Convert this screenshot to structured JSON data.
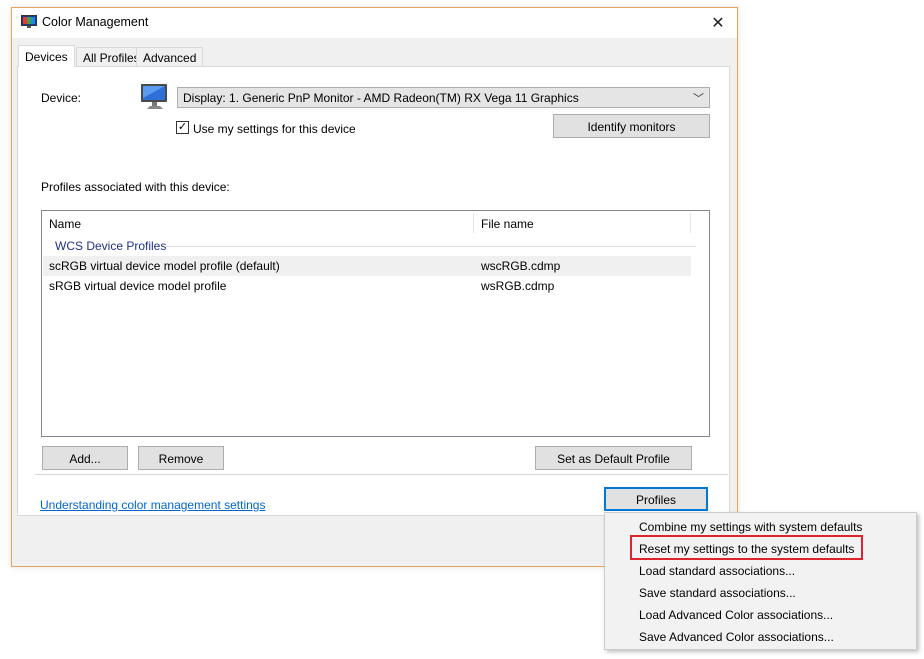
{
  "window": {
    "title": "Color Management",
    "close_symbol": "✕",
    "accent_color": "#e8a35c"
  },
  "tabs": [
    {
      "label": "Devices",
      "active": true
    },
    {
      "label": "All Profiles",
      "active": false
    },
    {
      "label": "Advanced",
      "active": false
    }
  ],
  "device": {
    "label": "Device:",
    "icon": "monitor-icon",
    "selected": "Display: 1. Generic PnP Monitor - AMD Radeon(TM) RX Vega 11 Graphics",
    "use_my_settings_label": "Use my settings for this device",
    "use_my_settings_checked": true,
    "identify_button": "Identify monitors"
  },
  "profiles": {
    "section_label": "Profiles associated with this device:",
    "columns": [
      "Name",
      "File name"
    ],
    "group": "WCS Device Profiles",
    "rows": [
      {
        "name": "scRGB virtual device model profile (default)",
        "file": "wscRGB.cdmp",
        "selected": true
      },
      {
        "name": "sRGB virtual device model profile",
        "file": "wsRGB.cdmp",
        "selected": false
      }
    ],
    "add_button": "Add...",
    "remove_button": "Remove",
    "default_button": "Set as Default Profile"
  },
  "footer": {
    "link": "Understanding color management settings",
    "profiles_button": "Profiles"
  },
  "menu": {
    "items": [
      "Combine my settings with system defaults",
      "Reset my settings to the system defaults",
      "Load standard associations...",
      "Save standard associations...",
      "Load Advanced Color associations...",
      "Save Advanced Color associations..."
    ],
    "highlighted_index": 1,
    "highlight_color": "#e0252a"
  }
}
